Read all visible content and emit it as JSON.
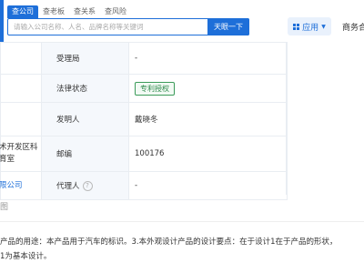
{
  "header": {
    "search_tabs": [
      "查公司",
      "查老板",
      "查关系",
      "查风险"
    ],
    "search": {
      "placeholder": "请输入公司名称、人名、品牌名称等关键词",
      "value": "",
      "button_label": "天眼一下"
    },
    "app_menu_label": "应用",
    "business_label": "商务合"
  },
  "table": {
    "rows": [
      {
        "left": "",
        "label": "受理局",
        "value": "-"
      },
      {
        "left": "",
        "label": "法律状态",
        "value": "专利授权"
      },
      {
        "left": "",
        "label": "发明人",
        "value": "戴晓冬"
      },
      {
        "left_line1": "术开发区科",
        "left_line2": "育室",
        "label": "邮编",
        "value": "100176"
      },
      {
        "left": "限公司",
        "label": "代理人",
        "value": "-"
      }
    ]
  },
  "section": {
    "title": "图"
  },
  "description": {
    "line1": "产品的用途：本产品用于汽车的标识。3.本外观设计产品的设计要点：在于设计1在于产品的形状，",
    "line2": "1为基本设计。"
  },
  "colors": {
    "brand_blue": "#1e6fd9",
    "status_green": "#2d8a4b"
  },
  "icons": [
    "clear-icon",
    "grid-icon",
    "caret-down-icon",
    "help-icon"
  ]
}
